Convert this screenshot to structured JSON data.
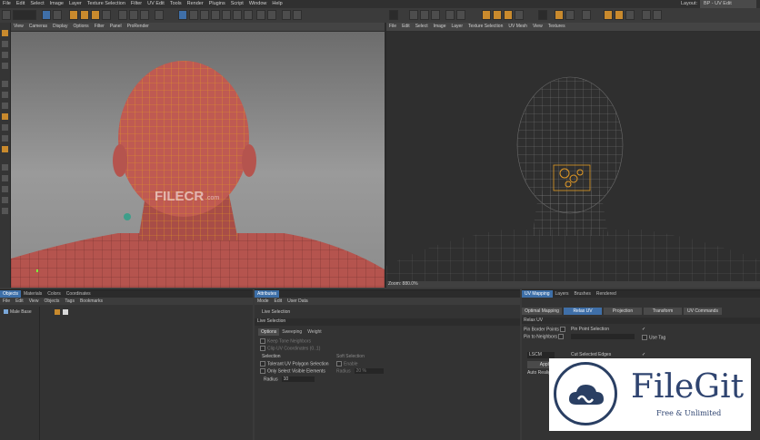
{
  "menubar": {
    "items": [
      "File",
      "Edit",
      "Select",
      "Image",
      "Layer",
      "Texture Selection",
      "Filter",
      "UV Edit",
      "Tools",
      "Render",
      "Plugins",
      "Script",
      "Window",
      "Help"
    ],
    "layout_label": "Layout:",
    "layout_value": "BP - UV Edit"
  },
  "viewport_left": {
    "menu": [
      "View",
      "Cameras",
      "Display",
      "Options",
      "Filter",
      "Panel",
      "ProRender"
    ],
    "overlay_text": "FILECR",
    "overlay_sub": ".com"
  },
  "viewport_right": {
    "menu": [
      "File",
      "Edit",
      "Select",
      "Image",
      "Layer",
      "Texture Selection",
      "UV Mesh",
      "View",
      "Textures"
    ],
    "zoom": "Zoom: 880.0%"
  },
  "objects_panel": {
    "tabs": [
      "Objects",
      "Materials",
      "Colors",
      "Coordinates"
    ],
    "menu": [
      "File",
      "Edit",
      "View",
      "Objects",
      "Tags",
      "Bookmarks"
    ],
    "item": "Male Base"
  },
  "attributes_panel": {
    "tabs": [
      "Attributes"
    ],
    "menu": [
      "Mode",
      "Edit",
      "User Data"
    ],
    "live_selection": "Live Selection",
    "title": "Live Selection",
    "subtabs": [
      "Options",
      "Sweeping",
      "Weight"
    ],
    "opt_keep_neighbors": "Keep Tone Neighbors",
    "opt_clip_uv": "Clip UV Coordinates (0..1)",
    "selection_header": "Selection",
    "soft_header": "Soft Selection",
    "tolerant": "Tolerant UV Polygon Selection",
    "enable": "Enable",
    "only_visible": "Only Select Visible Elements",
    "radius_soft": "Radius",
    "radius_soft_value": "20 %",
    "radius": "Radius",
    "radius_value": "10"
  },
  "uv_panel": {
    "tabs": [
      "UV Mapping",
      "Layers",
      "Brushes",
      "Rendered"
    ],
    "buttons": [
      "Optimal Mapping",
      "Relax UV",
      "Projection",
      "Transform",
      "UV Commands"
    ],
    "section": "Relax UV",
    "pin_border": "Pin Border Points",
    "pin_point_sel": "Pin Point Selection",
    "pin_neighbors": "Pin to Neighbors",
    "use_tag": "Use Tag",
    "method": "LSCM",
    "cut_edges": "Cut Selected Edges",
    "apply": "Apply",
    "auto_realign": "Auto Realign"
  },
  "watermark": {
    "name": "FileGit",
    "tagline": "Free & Unlimited"
  },
  "colors": {
    "accent_blue": "#3f6fa8",
    "wire_orange": "#e39a25",
    "skin": "#b5544e"
  }
}
